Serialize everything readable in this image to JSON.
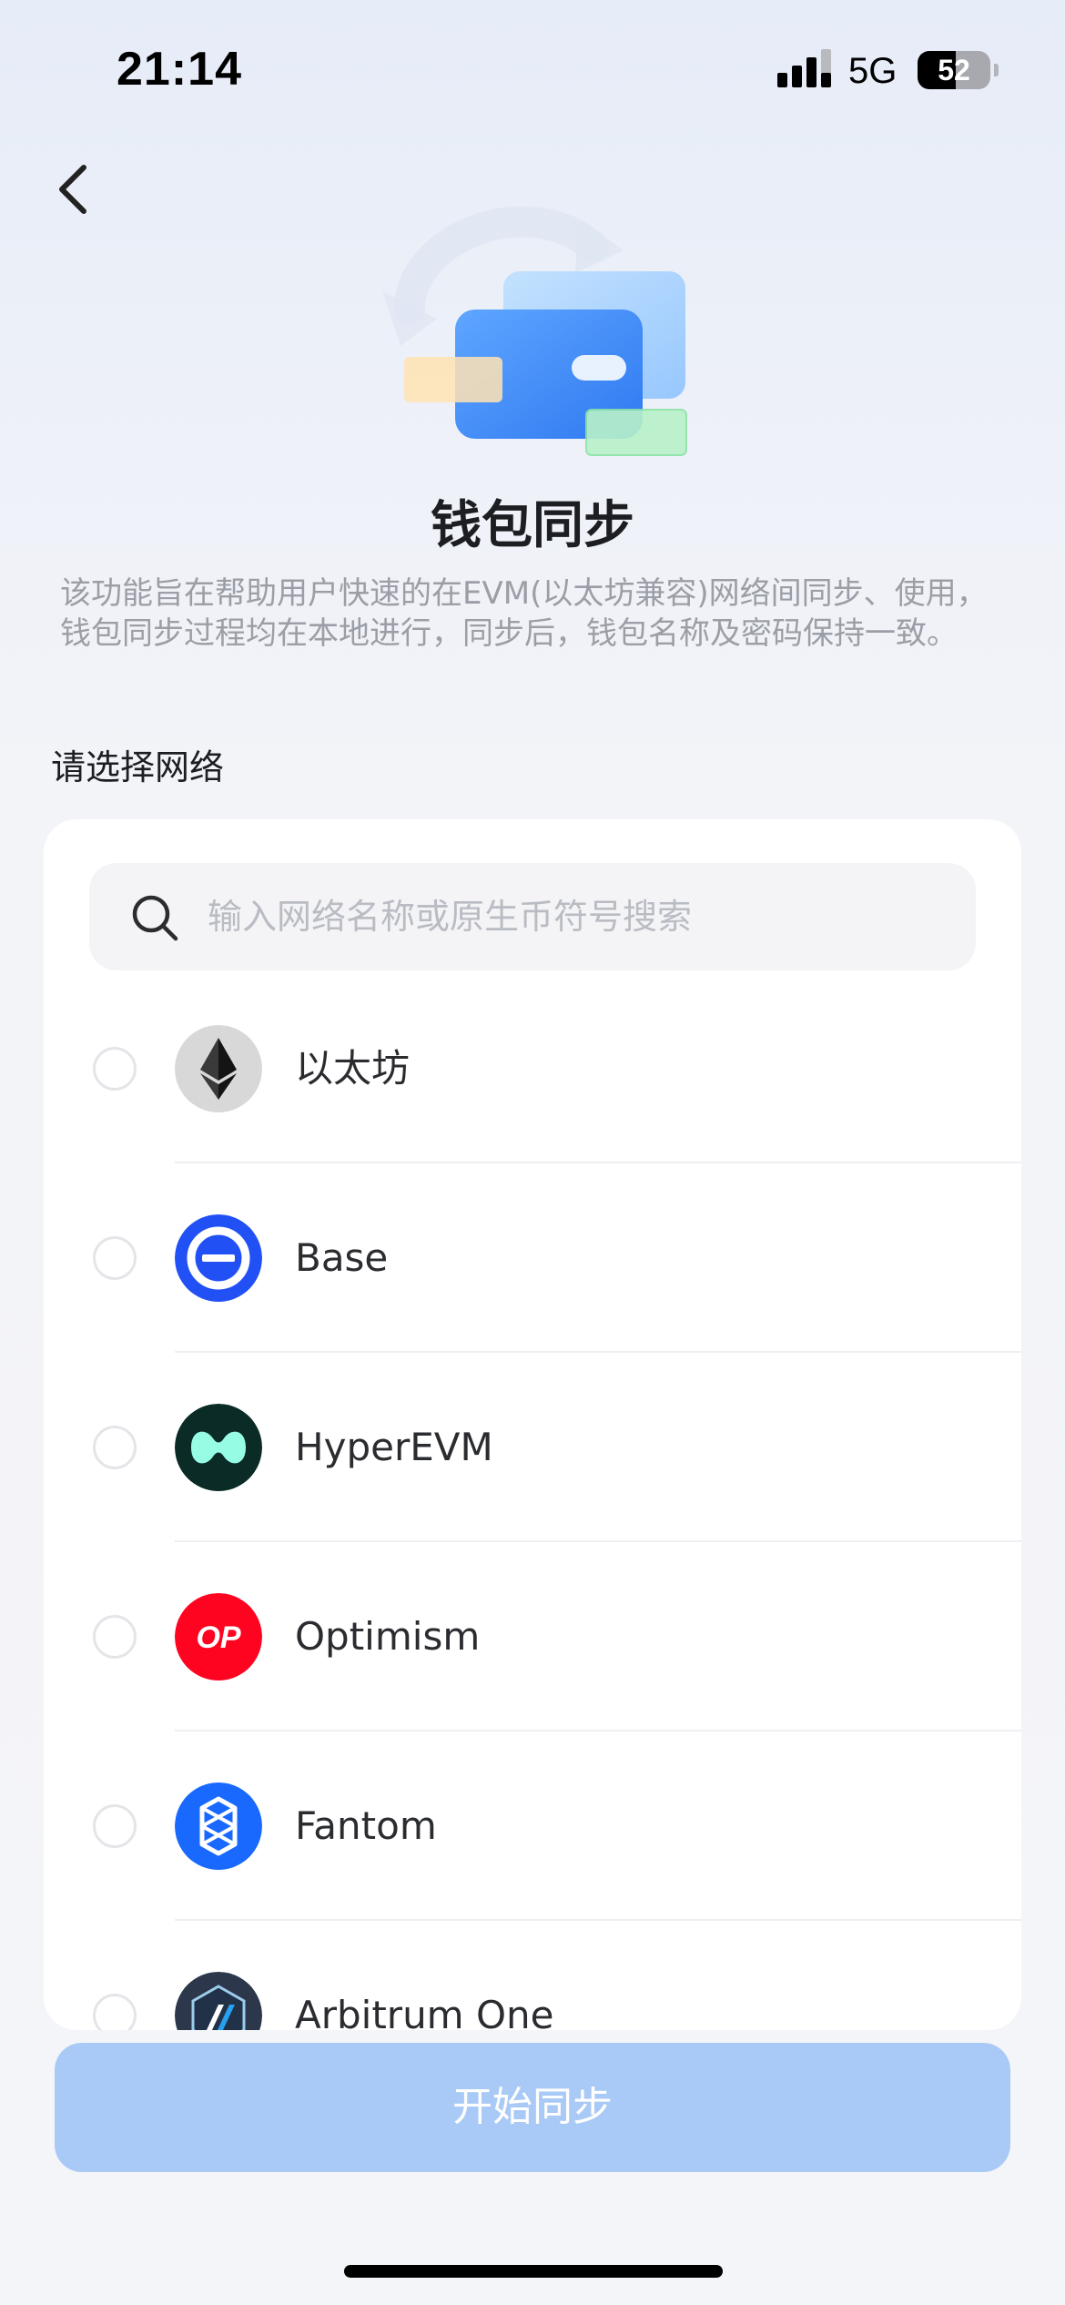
{
  "status_bar": {
    "time": "21:14",
    "network": "5G",
    "battery_level": "52",
    "battery_fraction": 0.52
  },
  "header": {
    "back_icon": "chevron-left-icon",
    "hero_icon": "wallet-sync-illustration"
  },
  "title": "钱包同步",
  "description": "该功能旨在帮助用户快速的在EVM(以太坊兼容)网络间同步、使用，钱包同步过程均在本地进行，同步后，钱包名称及密码保持一致。",
  "section_label": "请选择网络",
  "search": {
    "placeholder": "输入网络名称或原生币符号搜索",
    "value": "",
    "icon": "search-icon"
  },
  "networks": [
    {
      "name": "以太坊",
      "icon": "ethereum-logo-icon",
      "selected": false,
      "color": "#d8d8d8"
    },
    {
      "name": "Base",
      "icon": "base-logo-icon",
      "selected": false,
      "color": "#2151f5"
    },
    {
      "name": "HyperEVM",
      "icon": "hyperevm-logo-icon",
      "selected": false,
      "color": "#0b2b26"
    },
    {
      "name": "Optimism",
      "icon": "optimism-logo-icon",
      "selected": false,
      "color": "#ff0420"
    },
    {
      "name": "Fantom",
      "icon": "fantom-logo-icon",
      "selected": false,
      "color": "#1969ff"
    },
    {
      "name": "Arbitrum One",
      "icon": "arbitrum-logo-icon",
      "selected": false,
      "color": "#2d374b"
    }
  ],
  "sync_button": {
    "label": "开始同步",
    "color": "#a9c9f6"
  },
  "optimism_logo_text": "OP"
}
